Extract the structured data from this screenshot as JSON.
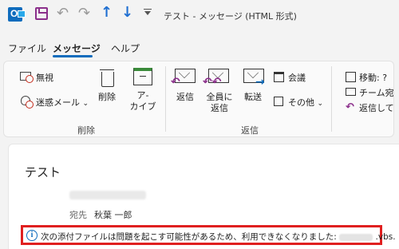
{
  "window": {
    "title": "テスト - メッセージ (HTML 形式)"
  },
  "tabs": [
    {
      "label": "ファイル"
    },
    {
      "label": "メッセージ",
      "active": true
    },
    {
      "label": "ヘルプ"
    }
  ],
  "ribbon": {
    "delete_group": {
      "label": "削除",
      "ignore": "無視",
      "junk": "迷惑メール",
      "delete": "削除",
      "archive_line1": "ア-",
      "archive_line2": "カイブ"
    },
    "reply_group": {
      "label": "返信",
      "reply": "返信",
      "replyall_line1": "全員に",
      "replyall_line2": "返信",
      "forward": "転送",
      "meeting": "会議",
      "more": "その他"
    },
    "quick_steps": {
      "move": "移動: ?",
      "team": "チーム宛て電",
      "reply_delete": "返信して削除"
    }
  },
  "message": {
    "subject": "テスト",
    "to_label": "宛先",
    "to_value": "秋葉 一郎",
    "info_text": "次の添付ファイルは問題を起こす可能性があるため、利用できなくなりました:",
    "attachment_ext": ".vbs."
  },
  "colors": {
    "accent": "#0f6cbd",
    "alert_border": "#e02020",
    "brand_purple": "#8b2f8b"
  }
}
